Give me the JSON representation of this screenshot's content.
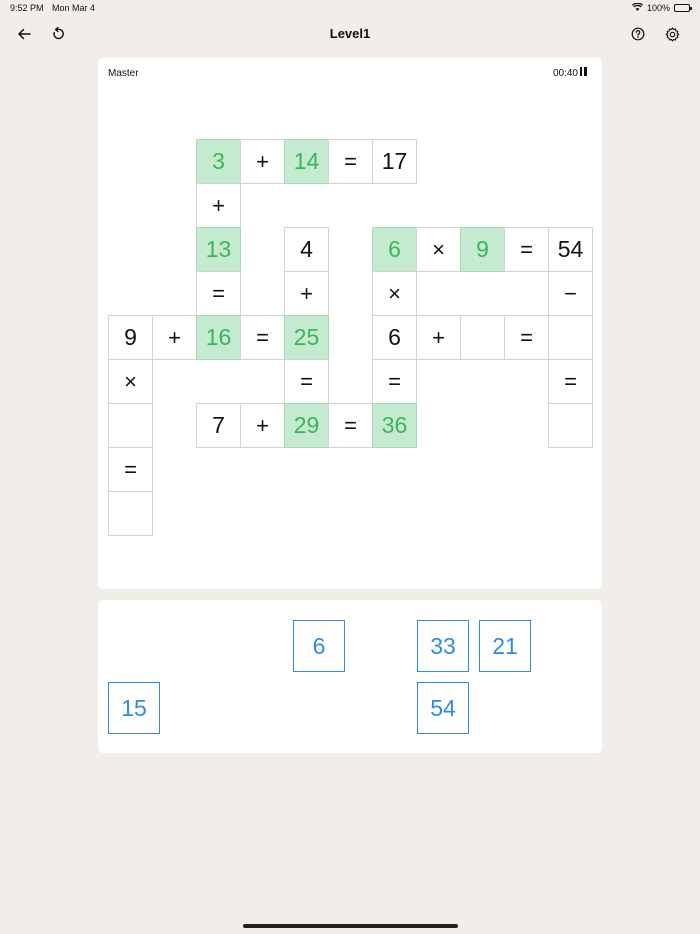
{
  "status_bar": {
    "time": "9:52 PM",
    "date": "Mon Mar 4",
    "battery": "100%"
  },
  "nav": {
    "title": "Level1",
    "icons": [
      "back-arrow-icon",
      "restart-icon",
      "help-icon",
      "settings-icon"
    ]
  },
  "board": {
    "difficulty": "Master",
    "timer": "00:40",
    "rows": [
      [
        {
          "c": 2,
          "v": "3",
          "t": "filled"
        },
        {
          "c": 3,
          "v": "+",
          "t": "op"
        },
        {
          "c": 4,
          "v": "14",
          "t": "filled"
        },
        {
          "c": 5,
          "v": "=",
          "t": "op"
        },
        {
          "c": 6,
          "v": "17",
          "t": "given"
        }
      ],
      [
        {
          "c": 2,
          "v": "+",
          "t": "op"
        }
      ],
      [
        {
          "c": 2,
          "v": "13",
          "t": "filled"
        },
        {
          "c": 4,
          "v": "4",
          "t": "given"
        },
        {
          "c": 6,
          "v": "6",
          "t": "filled"
        },
        {
          "c": 7,
          "v": "×",
          "t": "op"
        },
        {
          "c": 8,
          "v": "9",
          "t": "filled"
        },
        {
          "c": 9,
          "v": "=",
          "t": "op"
        },
        {
          "c": 10,
          "v": "54",
          "t": "given"
        }
      ],
      [
        {
          "c": 2,
          "v": "=",
          "t": "op"
        },
        {
          "c": 4,
          "v": "+",
          "t": "op"
        },
        {
          "c": 6,
          "v": "×",
          "t": "op"
        },
        {
          "c": 10,
          "v": "−",
          "t": "op"
        }
      ],
      [
        {
          "c": 0,
          "v": "9",
          "t": "given"
        },
        {
          "c": 1,
          "v": "+",
          "t": "op"
        },
        {
          "c": 2,
          "v": "16",
          "t": "filled"
        },
        {
          "c": 3,
          "v": "=",
          "t": "op"
        },
        {
          "c": 4,
          "v": "25",
          "t": "filled"
        },
        {
          "c": 6,
          "v": "6",
          "t": "given"
        },
        {
          "c": 7,
          "v": "+",
          "t": "op"
        },
        {
          "c": 8,
          "v": "",
          "t": "empty"
        },
        {
          "c": 9,
          "v": "=",
          "t": "op"
        },
        {
          "c": 10,
          "v": "",
          "t": "empty"
        }
      ],
      [
        {
          "c": 0,
          "v": "×",
          "t": "op"
        },
        {
          "c": 4,
          "v": "=",
          "t": "op"
        },
        {
          "c": 6,
          "v": "=",
          "t": "op"
        },
        {
          "c": 10,
          "v": "=",
          "t": "op"
        }
      ],
      [
        {
          "c": 0,
          "v": "",
          "t": "empty"
        },
        {
          "c": 2,
          "v": "7",
          "t": "given"
        },
        {
          "c": 3,
          "v": "+",
          "t": "op"
        },
        {
          "c": 4,
          "v": "29",
          "t": "filled"
        },
        {
          "c": 5,
          "v": "=",
          "t": "op"
        },
        {
          "c": 6,
          "v": "36",
          "t": "filled"
        },
        {
          "c": 10,
          "v": "",
          "t": "empty"
        }
      ],
      [
        {
          "c": 0,
          "v": "=",
          "t": "op"
        }
      ],
      [
        {
          "c": 0,
          "v": "",
          "t": "empty"
        }
      ]
    ]
  },
  "tray": {
    "tiles": [
      {
        "v": "6",
        "slot": "r0c3"
      },
      {
        "v": "33",
        "slot": "r0c5"
      },
      {
        "v": "21",
        "slot": "r0c6"
      },
      {
        "v": "15",
        "slot": "r1c0"
      },
      {
        "v": "54",
        "slot": "r1c5"
      }
    ]
  }
}
